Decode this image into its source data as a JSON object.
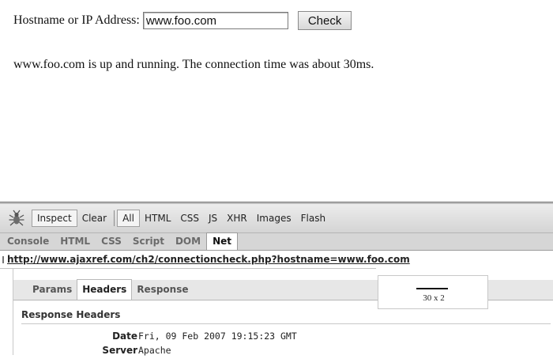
{
  "page": {
    "form_label": "Hostname or IP Address:",
    "hostname_value": "www.foo.com",
    "check_button": "Check",
    "result": "www.foo.com is up and running. The connection time was about 30ms."
  },
  "firebug": {
    "toolbar": {
      "inspect": "Inspect",
      "clear": "Clear",
      "filters": [
        "All",
        "HTML",
        "CSS",
        "JS",
        "XHR",
        "Images",
        "Flash"
      ],
      "active_filter": "All"
    },
    "tabs": [
      "Console",
      "HTML",
      "CSS",
      "Script",
      "DOM",
      "Net"
    ],
    "active_tab": "Net",
    "request_url": "http://www.ajaxref.com/ch2/connectioncheck.php?hostname=www.foo.com",
    "subtabs": [
      "Params",
      "Headers",
      "Response"
    ],
    "active_subtab": "Headers",
    "tooltip": "30 x 2",
    "section_title": "Response Headers",
    "headers": [
      {
        "name": "Date",
        "value": "Fri, 09 Feb 2007 19:15:23 GMT"
      },
      {
        "name": "Server",
        "value": "Apache"
      }
    ]
  }
}
